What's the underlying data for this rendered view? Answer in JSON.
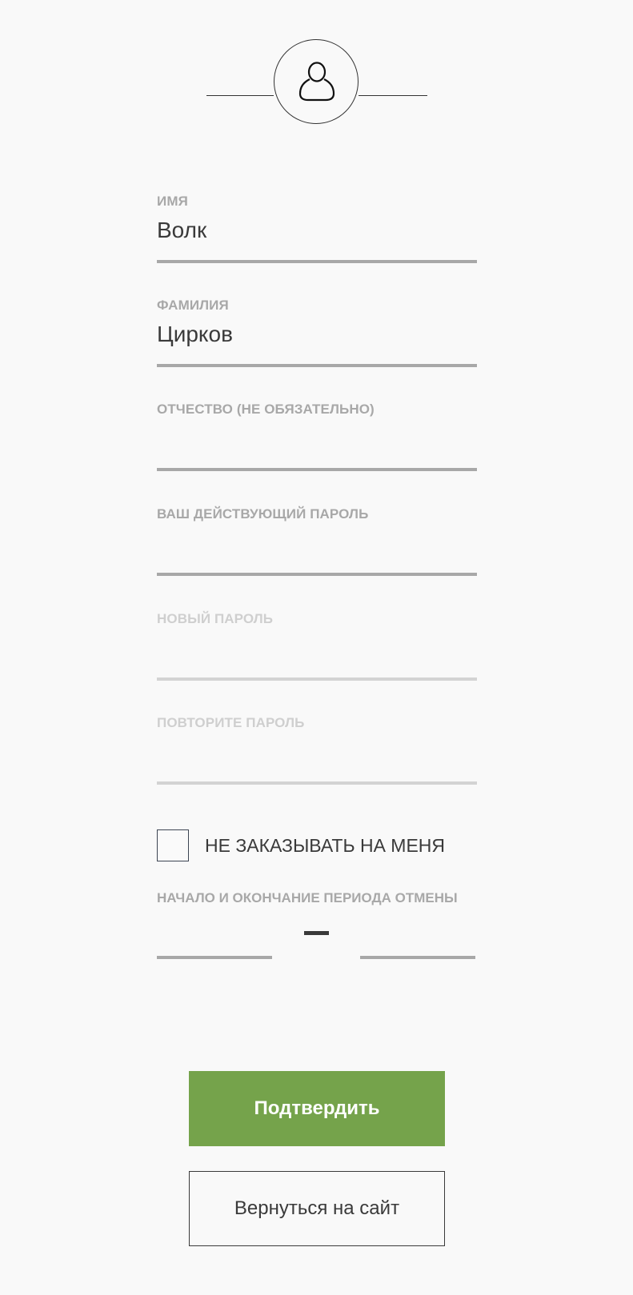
{
  "avatar": {
    "icon": "user-icon"
  },
  "fields": [
    {
      "label": "ИМЯ",
      "value": "Волк",
      "placeholder": ""
    },
    {
      "label": "ФАМИЛИЯ",
      "value": "Цирков",
      "placeholder": ""
    },
    {
      "label": "ОТЧЕСТВО (НЕ ОБЯЗАТЕЛЬНО)",
      "value": "",
      "placeholder": ""
    },
    {
      "label": "ВАШ ДЕЙСТВУЮЩИЙ ПАРОЛЬ",
      "value": "",
      "placeholder": ""
    },
    {
      "label": "НОВЫЙ ПАРОЛЬ",
      "value": "",
      "placeholder": ""
    },
    {
      "label": "ПОВТОРИТЕ ПАРОЛЬ",
      "value": "",
      "placeholder": ""
    }
  ],
  "no_order": {
    "label": "НЕ ЗАКАЗЫВАТЬ НА МЕНЯ",
    "checked": false
  },
  "period": {
    "label": "НАЧАЛО И ОКОНЧАНИЕ ПЕРИОДА ОТМЕНЫ",
    "start": "",
    "end": ""
  },
  "buttons": {
    "confirm": "Подтвердить",
    "back": "Вернуться на сайт"
  },
  "colors": {
    "background": "#f9f9f9",
    "accent": "#75a34b",
    "text": "#3a3a3a",
    "label": "#a8a8a8",
    "label_disabled": "#cfcfcf"
  }
}
